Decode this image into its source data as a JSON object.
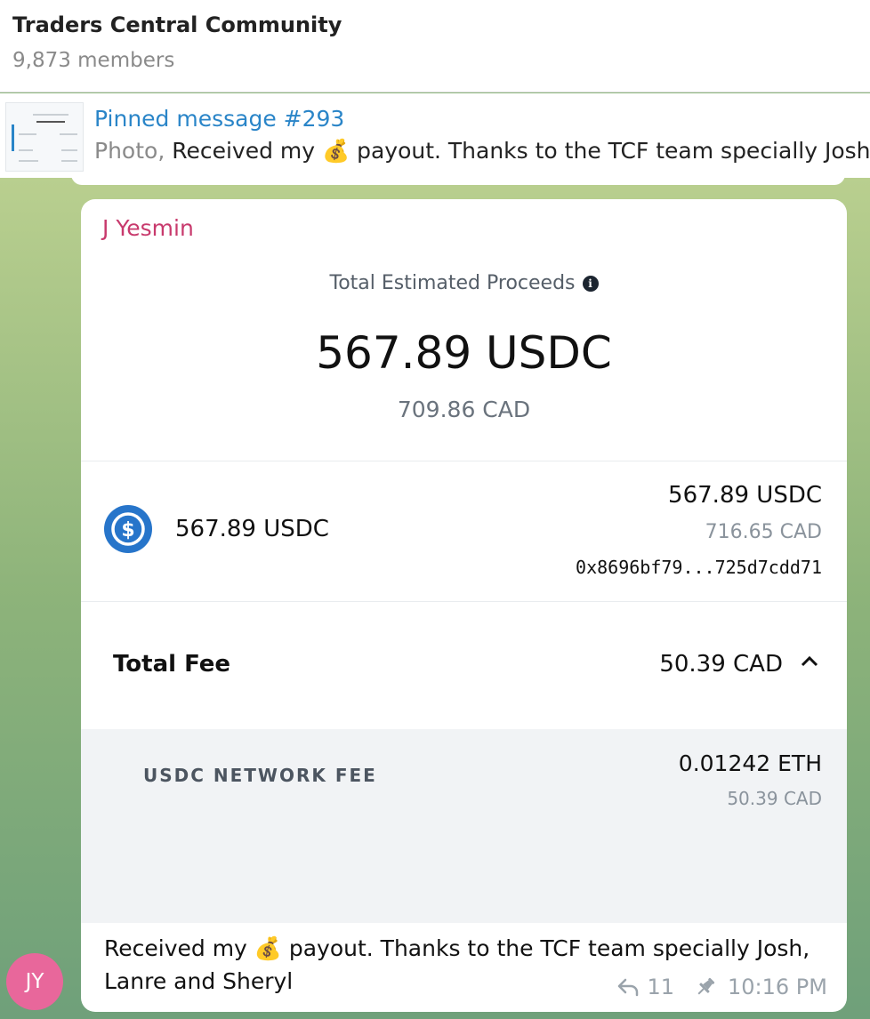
{
  "header": {
    "title": "Traders Central Community",
    "members": "9,873 members"
  },
  "pinned": {
    "title": "Pinned message #293",
    "prefix": "Photo, ",
    "text": "Received my 💰 payout. Thanks to the TCF team specially Josh, La"
  },
  "message": {
    "sender": "J Yesmin",
    "photo": {
      "estimated_label": "Total Estimated Proceeds",
      "amount": "567.89 USDC",
      "amount_cad": "709.86 CAD",
      "coin_label": "567.89 USDC",
      "right_usdc": "567.89 USDC",
      "right_cad": "716.65 CAD",
      "address": "0x8696bf79...725d7cdd71",
      "fee_label": "Total Fee",
      "fee_value": "50.39 CAD",
      "network_fee_label": "USDC NETWORK FEE",
      "network_fee_eth": "0.01242 ETH",
      "network_fee_cad": "50.39 CAD"
    },
    "caption": "Received my 💰 payout. Thanks to the TCF team specially Josh, Lanre and Sheryl",
    "replies": "11",
    "time": "10:16 PM"
  },
  "avatar": {
    "initials": "JY",
    "color": "#e8679b"
  },
  "colors": {
    "accent": "#2a85c8",
    "sender": "#c83a6d",
    "usdc_blue": "#2775ca"
  }
}
